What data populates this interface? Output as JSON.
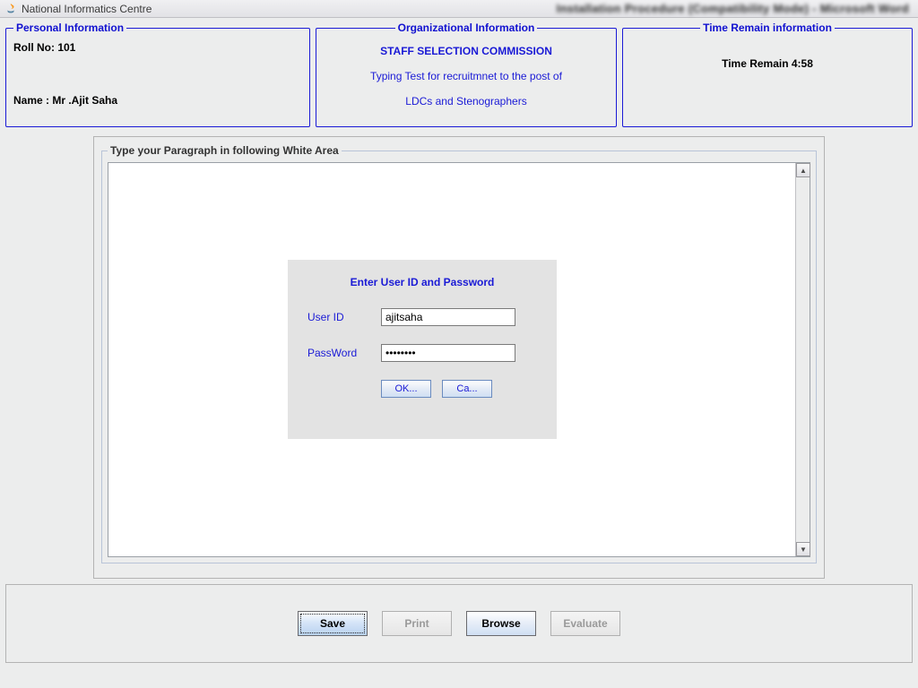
{
  "window": {
    "title": "National Informatics Centre",
    "background_blurred": "Installation Procedure (Compatibility Mode) - Microsoft Word"
  },
  "personal": {
    "legend": "Personal Information",
    "roll_label": "Roll No: 101",
    "name_label": "Name : Mr .Ajit Saha"
  },
  "organizational": {
    "legend": "Organizational Information",
    "line1": "STAFF SELECTION COMMISSION",
    "line2": "Typing Test for recruitmnet to the post of",
    "line3": "LDCs and Stenographers"
  },
  "time": {
    "legend": "Time Remain information",
    "text": "Time Remain 4:58"
  },
  "typing_area": {
    "legend": "Type your Paragraph in following White Area"
  },
  "login": {
    "title": "Enter User ID and Password",
    "userid_label": "User ID",
    "userid_value": "ajitsaha",
    "password_label": "PassWord",
    "password_value": "••••••••",
    "ok_label": "OK...",
    "cancel_label": "Ca..."
  },
  "buttons": {
    "save": "Save",
    "print": "Print",
    "browse": "Browse",
    "evaluate": "Evaluate"
  }
}
